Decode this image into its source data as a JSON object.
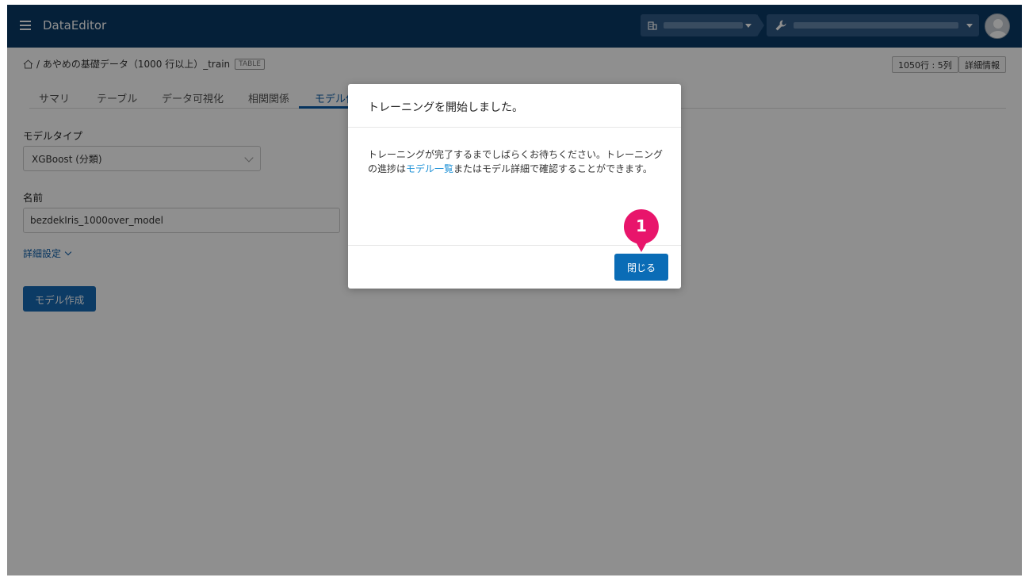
{
  "header": {
    "app_title": "DataEditor",
    "menu_icon": "hamburger-menu-icon",
    "org_icon": "building-icon",
    "project_icon": "wrench-icon"
  },
  "breadcrumb": {
    "path": "/ あやめの基礎データ（1000 行以上）_train",
    "tag": "TABLE"
  },
  "meta": {
    "shape": "1050行 : 5列",
    "details": "詳細情報"
  },
  "tabs": [
    {
      "label": "サマリ"
    },
    {
      "label": "テーブル"
    },
    {
      "label": "データ可視化"
    },
    {
      "label": "相関関係"
    },
    {
      "label": "モデル作"
    }
  ],
  "form": {
    "model_type_label": "モデルタイプ",
    "model_type_value": "XGBoost (分類)",
    "name_label": "名前",
    "name_value": "bezdekIris_1000over_model",
    "advanced_label": "詳細設定",
    "create_button": "モデル作成"
  },
  "modal": {
    "title": "トレーニングを開始しました。",
    "body_part1": "トレーニングが完了するまでしばらくお待ちください。トレーニングの進捗は",
    "body_link": "モデル一覧",
    "body_part2": "またはモデル詳細で確認することができます。",
    "close_button": "閉じる"
  },
  "callout": {
    "number": "1"
  },
  "colors": {
    "header_bg": "#0a3a66",
    "primary": "#0a6cb6",
    "link": "#1a8fd6",
    "callout": "#e8156b"
  }
}
